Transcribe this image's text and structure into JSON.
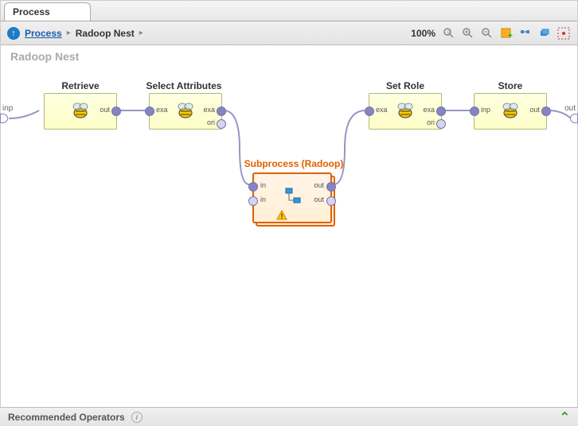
{
  "tab": {
    "title": "Process"
  },
  "breadcrumb": {
    "root": "Process",
    "current": "Radoop Nest"
  },
  "zoom": {
    "label": "100%"
  },
  "canvas": {
    "title": "Radoop Nest",
    "input_port": "inp",
    "output_port": "out"
  },
  "nodes": {
    "retrieve": {
      "title": "Retrieve",
      "port_out": "out"
    },
    "select": {
      "title": "Select Attributes",
      "port_in": "exa",
      "port_out1": "exa",
      "port_out2": "ori"
    },
    "setrole": {
      "title": "Set Role",
      "port_in": "exa",
      "port_out1": "exa",
      "port_out2": "ori"
    },
    "store": {
      "title": "Store",
      "port_in": "inp",
      "port_out": "out"
    },
    "subprocess": {
      "title": "Subprocess (Radoop)",
      "port_in": "in",
      "port_out": "out"
    }
  },
  "footer": {
    "label": "Recommended Operators"
  }
}
